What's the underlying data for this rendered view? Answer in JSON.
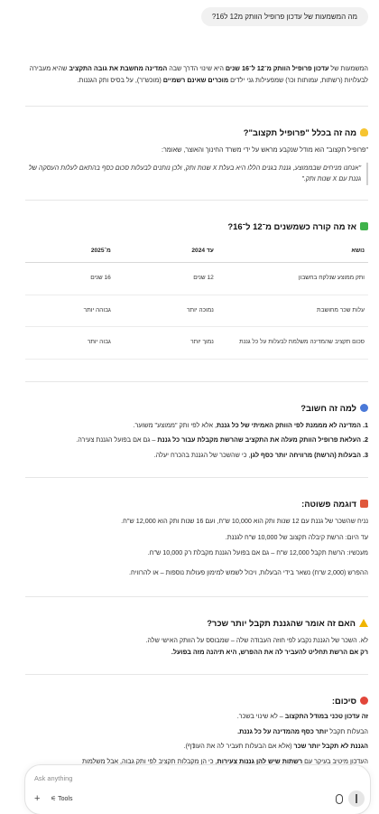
{
  "user_message": "מה המשמעות של עדכון פרופיל הוותק מ12 ל16?",
  "intro": {
    "part1": "המשמעות של ",
    "bold1": "עדכון פרופיל הוותק מ־12 ל־16 שנים",
    "part2": " היא שינוי הדרך שבה ",
    "bold2": "המדינה מחשבת את גובה התקציב",
    "part3": " שהיא מעבירה לבעלויות (רשתות, עמותות וכו') שמפעילות גני ילדים ",
    "bold3": "מוכרים שאינם רשמיים",
    "part4": " (מוכש\"ר), על בסיס ותק הגננות."
  },
  "section1": {
    "title": "מה זה בכלל \"פרופיל תקצוב\"?",
    "text": "\"פרופיל תקצוב\" הוא מודל שנקבע מראש על ידי משרד החינוך והאוצר, שאומר:",
    "quote": "\"אנחנו מניחים שבממוצע, גננת בגנים הללו היא בעלת X שנות ותק, ולכן נותנים לבעלות סכום כסף בהתאם לעלות העסקה של גננת עם X שנות ותק.\""
  },
  "section2": {
    "title": "אז מה קורה כשמשנים מ־12 ל־16?",
    "headers": [
      "נושא",
      "עד 2024",
      "מ־2025"
    ],
    "rows": [
      [
        "ותק ממוצע שנלקח בחשבון",
        "12 שנים",
        "16 שנים"
      ],
      [
        "עלות שכר מחושבת",
        "נמוכה יותר",
        "גבוהה יותר"
      ],
      [
        "סכום תקציב שהמדינה משלמת לבעלות על כל גננת",
        "נמוך יותר",
        "גבוה יותר"
      ]
    ]
  },
  "section3": {
    "title": "למה זה חשוב?",
    "items": [
      {
        "num": "1.",
        "bold": "המדינה לא מממנת לפי הוותק האמיתי של כל גננת",
        "rest": ", אלא לפי ותק \"ממוצע\" משוער."
      },
      {
        "num": "2.",
        "bold": "העלאת פרופיל הוותק מעלה את התקציב שהרשת מקבלת עבור כל גננת",
        "rest": " – גם אם בפועל הגננת צעירה."
      },
      {
        "num": "3.",
        "bold": "הבעלות (הרשת) מרוויחה יותר כסף לגן",
        "rest": ", כי שהשכר של הגננת בהכרח יעלה."
      }
    ]
  },
  "section4": {
    "title": "דוגמה פשוטה:",
    "line1": "נניח שהשכר של גננת עם 12 שנות ותק הוא 10,000 ש\"ח, ועם 16 שנות ותק הוא 12,000 ש\"ח.",
    "line2": "עד היום: הרשת קיבלה תקצוב של 10,000 ש\"ח לגננת.",
    "line3": "מעכשיו: הרשת תקבל 12,000 ש\"ח – גם אם בפועל הגננת מקבלת רק 10,000 ש\"ח.",
    "line4": "ההפרש (2,000 ש\"ח) נשאר בידי הבעלות, ויכול לשמש למימון פעולות נוספות – או להרוויח."
  },
  "section5": {
    "title": "האם זה אומר שהגננת תקבל יותר שכר?",
    "line1": "לא. השכר של הגננת נקבע לפי חוזה העבודה שלה – שמבוסס על הוותק האישי שלה.",
    "line2": "רק אם הרשת תחליט להעביר לה את ההפרש, היא תיהנה מזה בפועל."
  },
  "section6": {
    "title": "סיכום:",
    "line1_bold": "זה עדכון טכני במודל התקצוב",
    "line1_rest": " – לא שינוי בשכר.",
    "line2_pre": "הבעלות תקבל ",
    "line2_bold": "יותר כסף מהמדינה על כל גננת.",
    "line3_bold": "הגננת לא תקבל יותר שכר",
    "line3_rest": " (אלא אם הבעלות תעביר לה את העודף).",
    "line4_pre": "העדכון מיטיב בעיקר עם ",
    "line4_bold": "רשתות שיש להן גננות צעירות",
    "line4_rest": ", כי הן מקבלות תקציב לפי ותק גבוה, אבל משלמות"
  },
  "composer": {
    "placeholder": "Ask anything",
    "tools_label": "Tools"
  },
  "colors": {
    "bulb": "#f6c431",
    "check": "#3fb24b",
    "question": "#4a79d8",
    "abacus": "#e0583c",
    "warning": "#f0b400",
    "target": "#e2463a"
  }
}
